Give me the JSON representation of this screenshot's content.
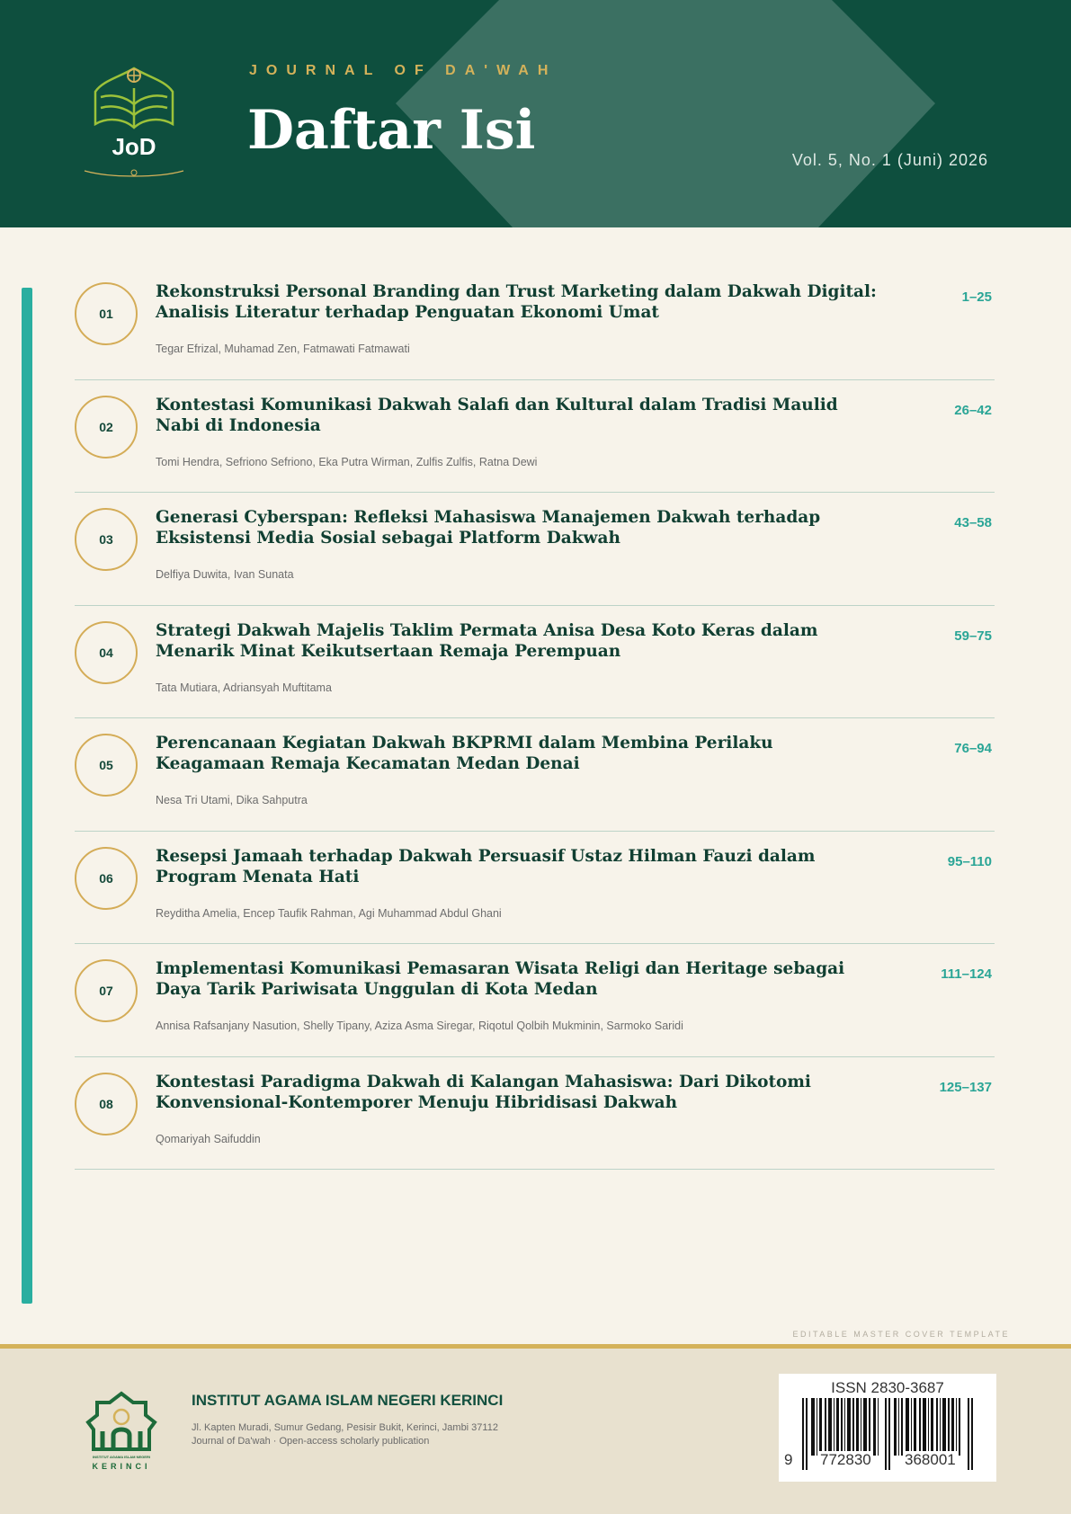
{
  "header": {
    "journal_name": "JOURNAL OF DA'WAH",
    "title": "Daftar Isi",
    "volume": "Vol. 5, No. 1 (Juni) 2026",
    "logo_text": "JoD"
  },
  "articles": [
    {
      "number": "01",
      "title": "Rekonstruksi Personal Branding dan Trust Marketing dalam Dakwah Digital: Analisis Literatur terhadap Penguatan Ekonomi Umat",
      "authors": "Tegar Efrizal, Muhamad Zen, Fatmawati Fatmawati",
      "pages": "1–25"
    },
    {
      "number": "02",
      "title": "Kontestasi Komunikasi Dakwah Salafi dan Kultural dalam Tradisi Maulid Nabi di Indonesia",
      "authors": "Tomi Hendra, Sefriono Sefriono, Eka Putra Wirman, Zulfis Zulfis, Ratna Dewi",
      "pages": "26–42"
    },
    {
      "number": "03",
      "title": "Generasi Cyberspan: Refleksi Mahasiswa Manajemen Dakwah terhadap Eksistensi Media Sosial sebagai Platform Dakwah",
      "authors": "Delfiya Duwita, Ivan Sunata",
      "pages": "43–58"
    },
    {
      "number": "04",
      "title": "Strategi Dakwah Majelis Taklim Permata Anisa Desa Koto Keras dalam Menarik Minat Keikutsertaan Remaja Perempuan",
      "authors": "Tata Mutiara, Adriansyah Muftitama",
      "pages": "59–75"
    },
    {
      "number": "05",
      "title": "Perencanaan Kegiatan Dakwah BKPRMI dalam Membina Perilaku Keagamaan Remaja Kecamatan Medan Denai",
      "authors": "Nesa Tri Utami, Dika Sahputra",
      "pages": "76–94"
    },
    {
      "number": "06",
      "title": "Resepsi Jamaah terhadap Dakwah Persuasif Ustaz Hilman Fauzi dalam Program Menata Hati",
      "authors": "Reyditha Amelia, Encep Taufik Rahman, Agi Muhammad Abdul Ghani",
      "pages": "95–110"
    },
    {
      "number": "07",
      "title": "Implementasi Komunikasi Pemasaran Wisata Religi dan Heritage sebagai Daya Tarik Pariwisata Unggulan di Kota Medan",
      "authors": "Annisa Rafsanjany Nasution, Shelly Tipany, Aziza Asma Siregar, Riqotul Qolbih Mukminin, Sarmoko Saridi",
      "pages": "111–124"
    },
    {
      "number": "08",
      "title": "Kontestasi Paradigma Dakwah di Kalangan Mahasiswa: Dari Dikotomi Konvensional-Kontemporer Menuju Hibridisasi Dakwah",
      "authors": "Qomariyah Saifuddin",
      "pages": "125–137"
    }
  ],
  "template_note": "EDITABLE MASTER COVER TEMPLATE",
  "footer": {
    "institution": "INSTITUT AGAMA ISLAM NEGERI KERINCI",
    "address": "Jl. Kapten Muradi, Sumur Gedang, Pesisir Bukit, Kerinci, Jambi 37112",
    "description": "Journal of Da'wah · Open-access scholarly publication",
    "logo_caption_small": "INSTITUT AGAMA ISLAM NEGERI",
    "logo_caption": "KERINCI",
    "issn": "ISSN 2830-3687",
    "barcode_first": "9",
    "barcode_left": "772830",
    "barcode_right": "368001"
  },
  "colors": {
    "header_green": "#0e4f3e",
    "gold": "#d4b25a",
    "teal": "#2aaea0",
    "title_green": "#113f32"
  }
}
